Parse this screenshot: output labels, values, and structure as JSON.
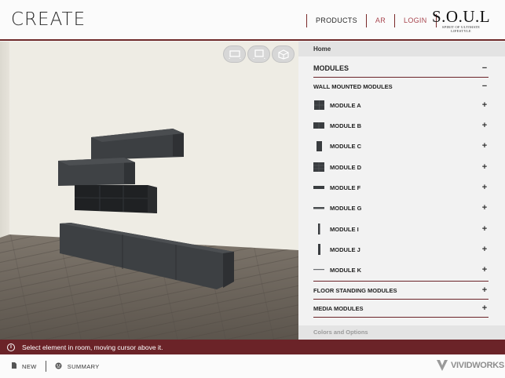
{
  "header": {
    "title": "CREATE",
    "nav": {
      "products": "PRODUCTS",
      "ar": "AR",
      "login": "LOGIN"
    },
    "brand": {
      "logo": "S.O.U.L",
      "tagline": "SPIRIT OF ULTIMATE LIFESTYLE"
    }
  },
  "viewport": {
    "view_buttons": [
      "front-view-icon",
      "top-view-icon",
      "3d-view-icon"
    ]
  },
  "panel": {
    "breadcrumb": "Home",
    "modules": {
      "label": "MODULES",
      "sign": "−"
    },
    "wall_mounted": {
      "label": "WALL MOUNTED MODULES",
      "sign": "−"
    },
    "items": [
      {
        "label": "MODULE A",
        "icon": "module-a-icon",
        "sign": "+"
      },
      {
        "label": "MODULE B",
        "icon": "module-b-icon",
        "sign": "+"
      },
      {
        "label": "MODULE C",
        "icon": "module-c-icon",
        "sign": "+"
      },
      {
        "label": "MODULE D",
        "icon": "module-d-icon",
        "sign": "+"
      },
      {
        "label": "MODULE F",
        "icon": "module-f-icon",
        "sign": "+"
      },
      {
        "label": "MODULE G",
        "icon": "module-g-icon",
        "sign": "+"
      },
      {
        "label": "MODULE I",
        "icon": "module-i-icon",
        "sign": "+"
      },
      {
        "label": "MODULE J",
        "icon": "module-j-icon",
        "sign": "+"
      },
      {
        "label": "MODULE K",
        "icon": "module-k-icon",
        "sign": "+"
      }
    ],
    "floor_standing": {
      "label": "FLOOR STANDING MODULES",
      "sign": "+"
    },
    "media": {
      "label": "MEDIA MODULES",
      "sign": "+"
    },
    "colors_options": "Colors and Options"
  },
  "status": {
    "message": "Select element in room, moving cursor above it."
  },
  "bottom": {
    "new": "NEW",
    "summary": "SUMMARY",
    "vendor": "VIVIDWORKS"
  },
  "colors": {
    "accent": "#6b2328",
    "nav_link": "#a8464f",
    "furniture": "#3a3d40"
  }
}
